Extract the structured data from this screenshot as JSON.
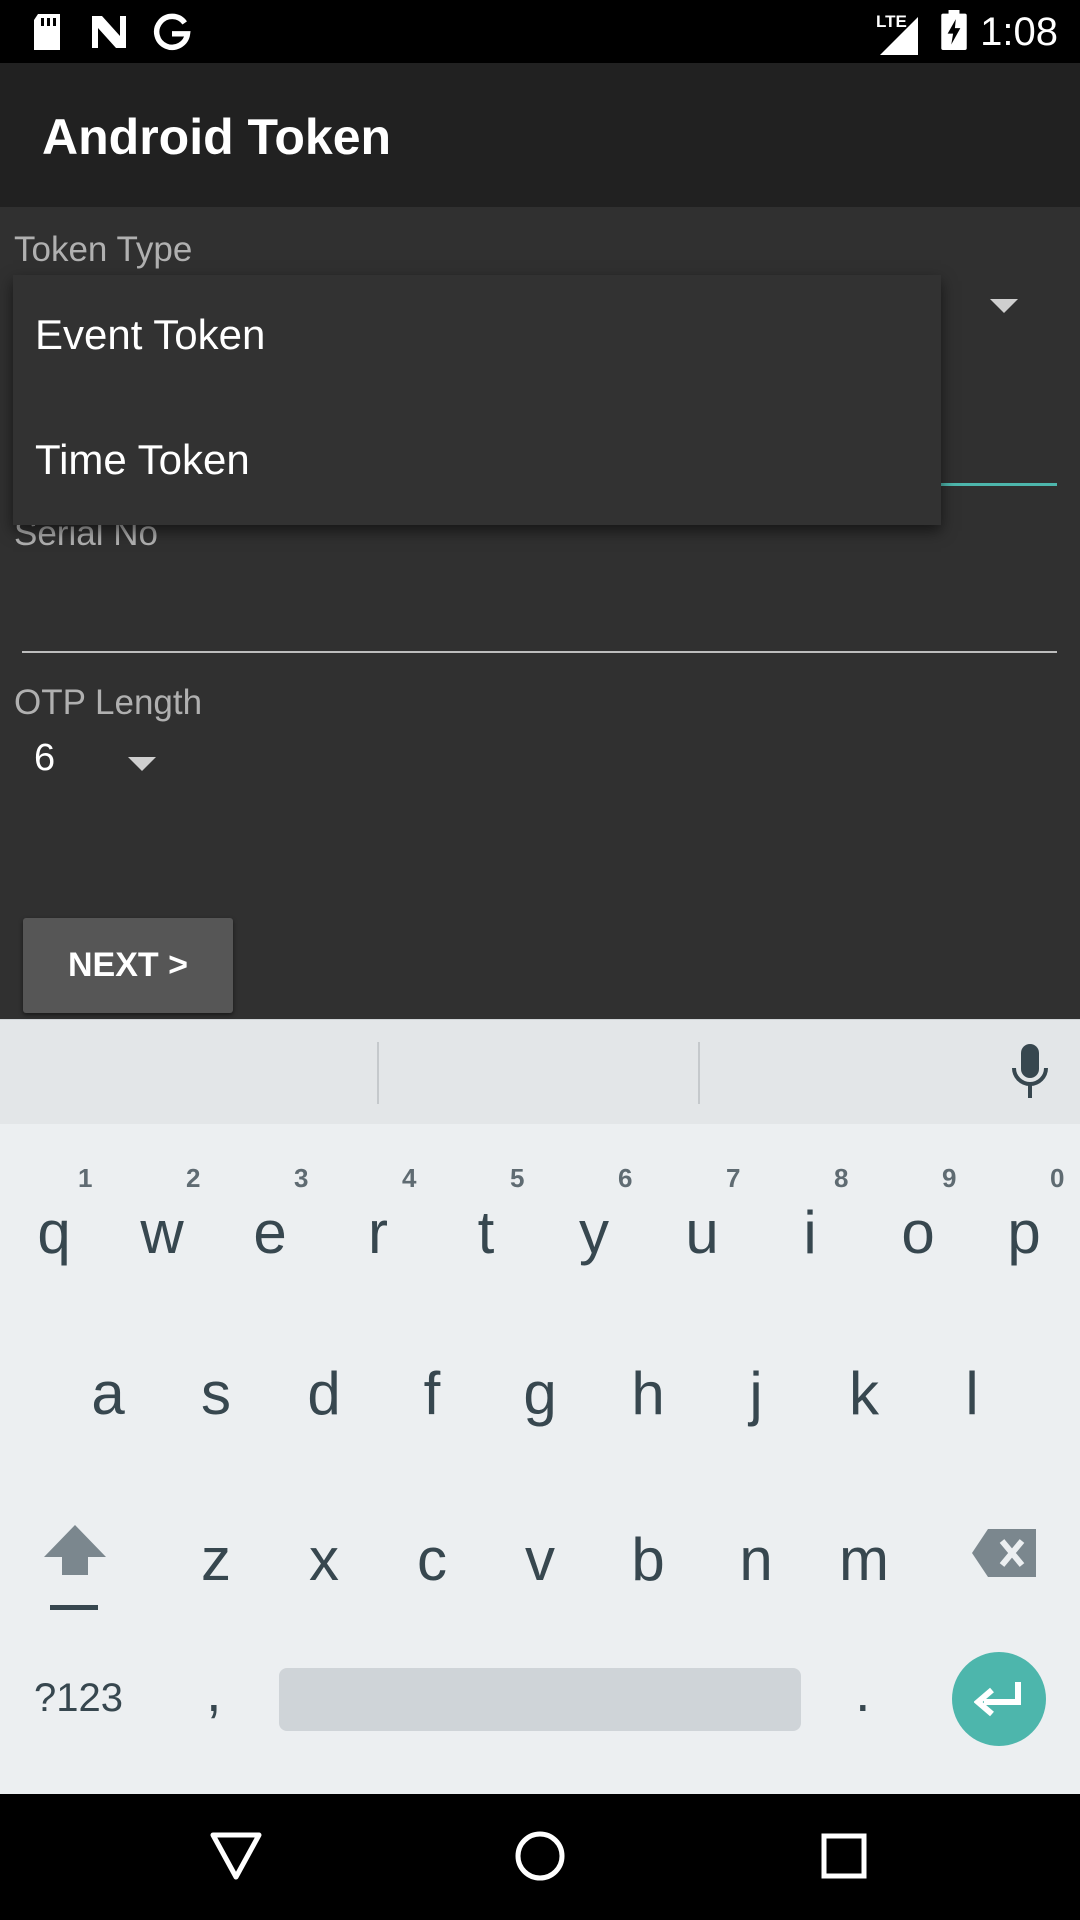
{
  "status_bar": {
    "time": "1:08",
    "network": "LTE",
    "icons": [
      "sd-card-icon",
      "n-notification-icon",
      "google-icon",
      "signal-icon",
      "battery-charging-icon"
    ]
  },
  "app_bar": {
    "title": "Android Token"
  },
  "form": {
    "token_type_label": "Token Type",
    "token_type_options": [
      "Event Token",
      "Time Token"
    ],
    "serial_label": "Serial No",
    "serial_value": "",
    "otp_label": "OTP Length",
    "otp_value": "6",
    "next_label": "NEXT >"
  },
  "keyboard": {
    "row1": [
      "q",
      "w",
      "e",
      "r",
      "t",
      "y",
      "u",
      "i",
      "o",
      "p"
    ],
    "row1_hints": [
      "1",
      "2",
      "3",
      "4",
      "5",
      "6",
      "7",
      "8",
      "9",
      "0"
    ],
    "row2": [
      "a",
      "s",
      "d",
      "f",
      "g",
      "h",
      "j",
      "k",
      "l"
    ],
    "row3": [
      "z",
      "x",
      "c",
      "v",
      "b",
      "n",
      "m"
    ],
    "symbols_label": "?123",
    "comma": ",",
    "period": "."
  },
  "colors": {
    "accent": "#4db6ac",
    "background": "#303030",
    "app_bar": "#212121"
  }
}
